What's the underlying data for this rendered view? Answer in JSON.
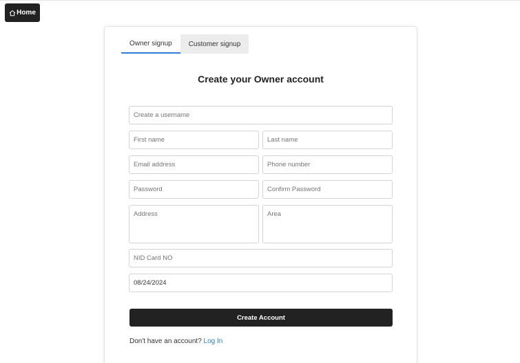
{
  "home": {
    "label": "Home",
    "icon": "home-icon"
  },
  "tabs": [
    {
      "label": "Owner signup",
      "active": true
    },
    {
      "label": "Customer signup",
      "active": false
    }
  ],
  "title": "Create your Owner account",
  "fields": {
    "username": {
      "placeholder": "Create a username",
      "value": ""
    },
    "first_name": {
      "placeholder": "First name",
      "value": ""
    },
    "last_name": {
      "placeholder": "Last name",
      "value": ""
    },
    "email": {
      "placeholder": "Email address",
      "value": ""
    },
    "phone": {
      "placeholder": "Phone number",
      "value": ""
    },
    "password": {
      "placeholder": "Password",
      "value": ""
    },
    "confirm_password": {
      "placeholder": "Confirm Password",
      "value": ""
    },
    "address": {
      "placeholder": "Address",
      "value": ""
    },
    "area": {
      "placeholder": "Area",
      "value": ""
    },
    "nid": {
      "placeholder": "NID Card NO",
      "value": ""
    },
    "date": {
      "value": "08/24/2024"
    }
  },
  "submit_label": "Create Account",
  "footer": {
    "text": "Don't have an account?",
    "link": "Log In"
  },
  "colors": {
    "accent": "#2b7fd6",
    "button_dark": "#222222"
  }
}
